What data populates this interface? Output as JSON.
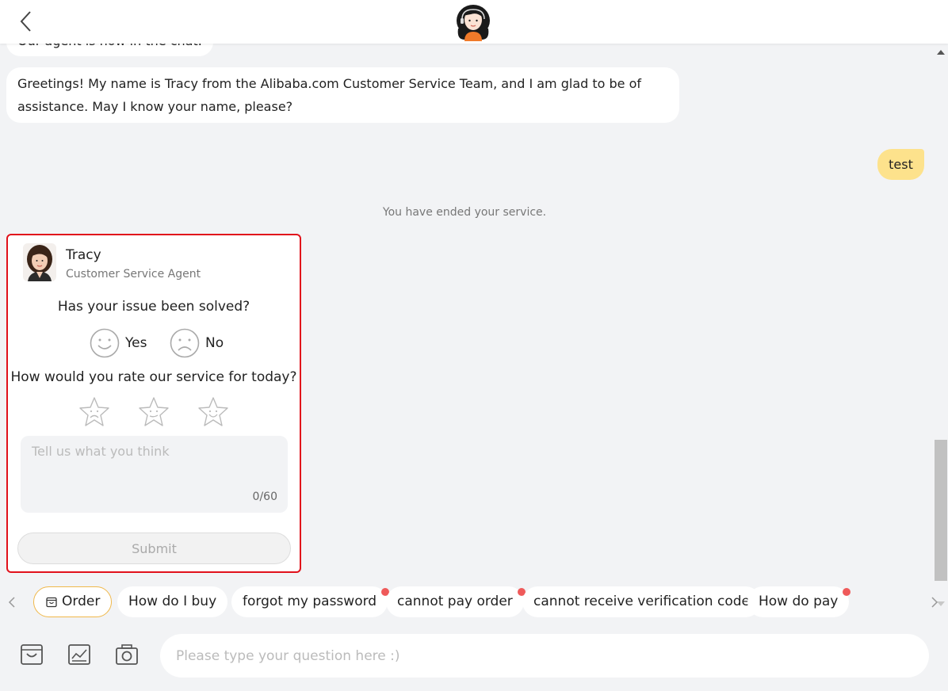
{
  "header": {
    "back_icon": "chevron-left-icon",
    "avatar_icon": "support-agent-avatar"
  },
  "messages": {
    "partial_text": "Our agent is now in the chat.",
    "greeting": "Greetings! My name is Tracy from the Alibaba.com Customer Service Team, and I am glad to be of assistance. May I know your name, please?",
    "user_message": "test",
    "system_note": "You have ended your service."
  },
  "survey": {
    "agent_name": "Tracy",
    "agent_role": "Customer Service Agent",
    "question_solved": "Has your issue been solved?",
    "yes_label": "Yes",
    "no_label": "No",
    "question_rate": "How would you rate our service for today?",
    "ratings": [
      "sad-star-icon",
      "neutral-star-icon",
      "happy-star-icon"
    ],
    "feedback_placeholder": "Tell us what you think",
    "counter": "0/60",
    "submit_label": "Submit",
    "highlight_color": "#e1111b"
  },
  "quick_replies": {
    "order_label": "Order",
    "items": [
      {
        "label": "How do I buy",
        "badge": false
      },
      {
        "label": "forgot my password",
        "badge": true
      },
      {
        "label": "cannot pay order",
        "badge": true
      },
      {
        "label": "cannot receive verification code",
        "badge": true
      },
      {
        "label": "How do pay",
        "badge": true
      }
    ]
  },
  "composer": {
    "placeholder": "Please type your question here :)",
    "tools": [
      "order-icon",
      "image-icon",
      "camera-icon"
    ]
  },
  "colors": {
    "user_bubble": "#fde28c",
    "accent": "#f0b84a",
    "badge": "#ef5a5a"
  }
}
